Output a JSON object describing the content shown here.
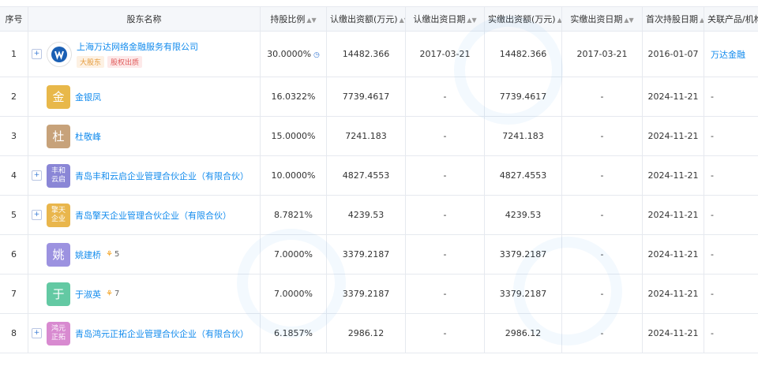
{
  "columns": [
    "序号",
    "股东名称",
    "持股比例",
    "认缴出资额(万元)",
    "认缴出资日期",
    "实缴出资额(万元)",
    "实缴出资日期",
    "首次持股日期",
    "关联产品/机构"
  ],
  "rows": [
    {
      "index": "1",
      "name": "上海万达网络金融服务有限公司",
      "avatar_text": "",
      "avatar_color": "",
      "tags": [
        "大股东",
        "股权出质"
      ],
      "ratio": "30.0000%",
      "sub_amount": "14482.366",
      "sub_date": "2017-03-21",
      "paid_amount": "14482.366",
      "paid_date": "2017-03-21",
      "first_date": "2016-01-07",
      "related": "万达金融",
      "expandable": true
    },
    {
      "index": "2",
      "name": "金银凤",
      "avatar_text": "金",
      "avatar_color": "#e8b84a",
      "ratio": "16.0322%",
      "sub_amount": "7739.4617",
      "sub_date": "-",
      "paid_amount": "7739.4617",
      "paid_date": "-",
      "first_date": "2024-11-21",
      "related": "-",
      "expandable": false
    },
    {
      "index": "3",
      "name": "杜敬峰",
      "avatar_text": "杜",
      "avatar_color": "#c7a27a",
      "ratio": "15.0000%",
      "sub_amount": "7241.183",
      "sub_date": "-",
      "paid_amount": "7241.183",
      "paid_date": "-",
      "first_date": "2024-11-21",
      "related": "-",
      "expandable": false
    },
    {
      "index": "4",
      "name": "青岛丰和云启企业管理合伙企业（有限合伙）",
      "avatar_text": "丰和\n云启",
      "avatar_color": "#8a86d6",
      "ratio": "10.0000%",
      "sub_amount": "4827.4553",
      "sub_date": "-",
      "paid_amount": "4827.4553",
      "paid_date": "-",
      "first_date": "2024-11-21",
      "related": "-",
      "expandable": true
    },
    {
      "index": "5",
      "name": "青岛擎天企业管理合伙企业（有限合伙）",
      "avatar_text": "擎天\n企业",
      "avatar_color": "#e9b64c",
      "ratio": "8.7821%",
      "sub_amount": "4239.53",
      "sub_date": "-",
      "paid_amount": "4239.53",
      "paid_date": "-",
      "first_date": "2024-11-21",
      "related": "-",
      "expandable": true
    },
    {
      "index": "6",
      "name": "姚建桥",
      "avatar_text": "姚",
      "avatar_color": "#9c92e0",
      "badge": "5",
      "ratio": "7.0000%",
      "sub_amount": "3379.2187",
      "sub_date": "-",
      "paid_amount": "3379.2187",
      "paid_date": "-",
      "first_date": "2024-11-21",
      "related": "-",
      "expandable": false
    },
    {
      "index": "7",
      "name": "于淑英",
      "avatar_text": "于",
      "avatar_color": "#63c9a3",
      "badge": "7",
      "ratio": "7.0000%",
      "sub_amount": "3379.2187",
      "sub_date": "-",
      "paid_amount": "3379.2187",
      "paid_date": "-",
      "first_date": "2024-11-21",
      "related": "-",
      "expandable": false
    },
    {
      "index": "8",
      "name": "青岛鸿元正拓企业管理合伙企业（有限合伙）",
      "avatar_text": "鸿元\n正拓",
      "avatar_color": "#d88ad0",
      "ratio": "6.1857%",
      "sub_amount": "2986.12",
      "sub_date": "-",
      "paid_amount": "2986.12",
      "paid_date": "-",
      "first_date": "2024-11-21",
      "related": "-",
      "expandable": true
    }
  ]
}
